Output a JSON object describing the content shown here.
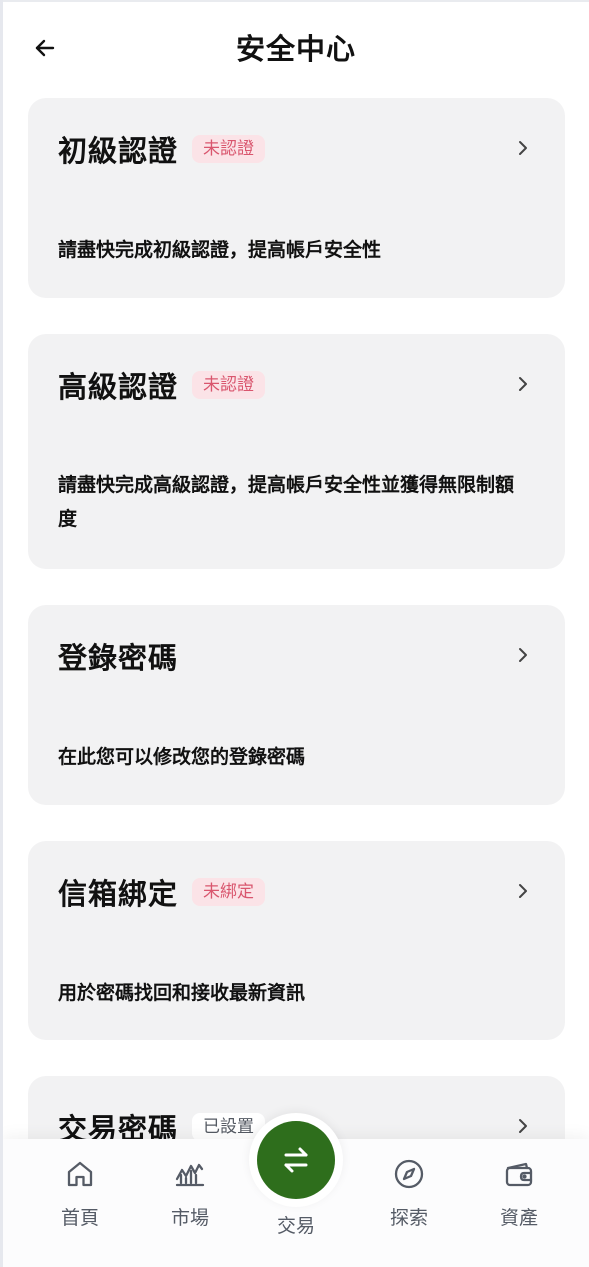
{
  "header": {
    "title": "安全中心"
  },
  "cards": [
    {
      "title": "初級認證",
      "badge": "未認證",
      "description": "請盡快完成初級認證，提高帳戶安全性"
    },
    {
      "title": "高級認證",
      "badge": "未認證",
      "description": "請盡快完成高級認證，提高帳戶安全性並獲得無限制額度"
    },
    {
      "title": "登錄密碼",
      "description": "在此您可以修改您的登錄密碼"
    },
    {
      "title": "信箱綁定",
      "badge": "未綁定",
      "description": "用於密碼找回和接收最新資訊"
    },
    {
      "title": "交易密碼",
      "badge": "已設置"
    }
  ],
  "tabbar": {
    "items": [
      {
        "label": "首頁",
        "icon": "home-icon"
      },
      {
        "label": "市場",
        "icon": "market-chart-icon"
      },
      {
        "label": "交易",
        "icon": "swap-arrows-icon"
      },
      {
        "label": "探索",
        "icon": "compass-icon"
      },
      {
        "label": "資產",
        "icon": "wallet-icon"
      }
    ]
  },
  "colors": {
    "card_bg": "#f2f2f3",
    "badge_warn_bg": "#fbe3e7",
    "badge_warn_text": "#d9566e",
    "trade_button": "#2e6e1c",
    "tab_text": "#555b66"
  }
}
